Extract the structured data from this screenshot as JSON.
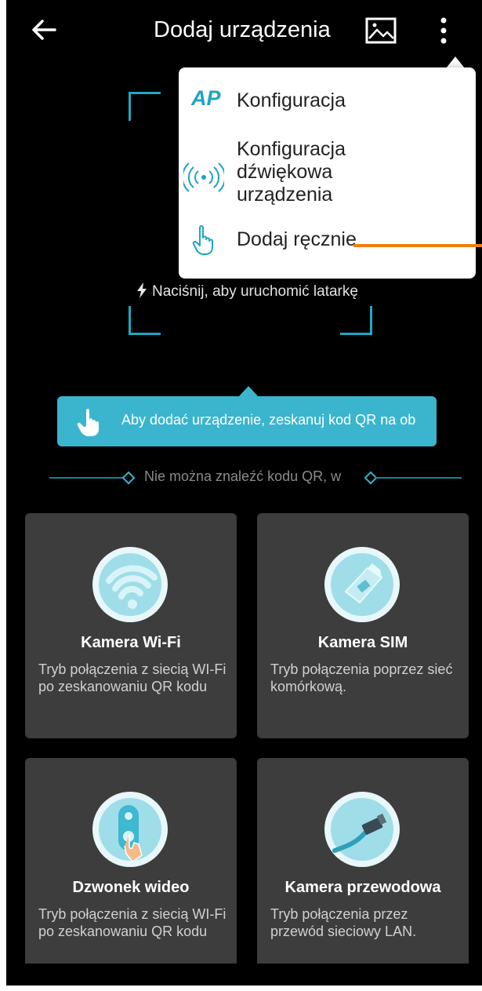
{
  "header": {
    "title": "Dodaj urządzenia",
    "back_icon": "back-arrow-icon",
    "gallery_icon": "image-icon",
    "menu_icon": "more-vert-icon"
  },
  "scanner": {
    "torch_text": "Naciśnij, aby uruchomić latarkę",
    "tooltip_text": "Aby dodać urządzenie, zeskanuj kod QR na ob",
    "divider_text": "Nie można znaleźć kodu QR, w"
  },
  "menu": {
    "items": [
      {
        "icon_text": "AP",
        "label": "Konfiguracja"
      },
      {
        "icon": "sound-wave-icon",
        "label": "Konfiguracja\ndźwiękowa\nurządzenia"
      },
      {
        "icon": "hand-pointer-icon",
        "label": "Dodaj ręcznie"
      }
    ]
  },
  "cards": [
    {
      "title": "Kamera Wi-Fi",
      "desc": "Tryb połączenia z siecią WI-Fi po zeskanowaniu QR kodu",
      "icon": "wifi-icon"
    },
    {
      "title": "Kamera SIM",
      "desc": "Tryb połączenia poprzez sieć komórkową.",
      "icon": "sim-card-icon"
    },
    {
      "title": "Dzwonek wideo",
      "desc": "Tryb połączenia z siecią WI-Fi po zeskanowaniu QR kodu",
      "icon": "doorbell-icon"
    },
    {
      "title": "Kamera przewodowa",
      "desc": "Tryb połączenia przez przewód sieciowy LAN.",
      "icon": "lan-cable-icon"
    }
  ],
  "colors": {
    "accent": "#3ab5cd",
    "background": "#000000",
    "card": "#3d3d3d",
    "annotation": "#f07f0f"
  }
}
